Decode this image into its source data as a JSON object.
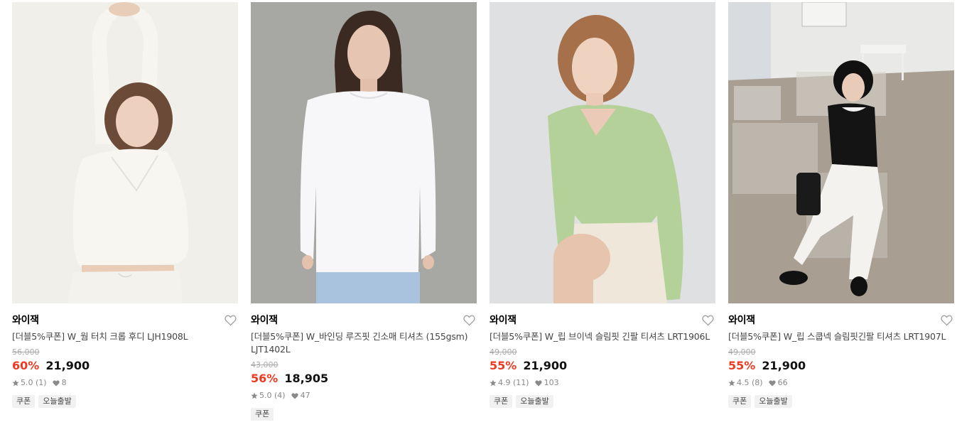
{
  "products": [
    {
      "brand": "와이잭",
      "title": "[더블5%쿠폰] W_웜 터치 크롭 후디 LJH1908L",
      "original_price": "56,000",
      "discount": "60%",
      "price": "21,900",
      "rating": "5.0 (1)",
      "likes": "8",
      "tags": [
        "쿠폰",
        "오늘출발"
      ],
      "image": "woman in cream cropped hoodie stretching arms overhead"
    },
    {
      "brand": "와이잭",
      "title": "[더블5%쿠폰] W_바인딩 루즈핏 긴소매 티셔츠 (155gsm) LJT1402L",
      "original_price": "43,000",
      "discount": "56%",
      "price": "18,905",
      "rating": "5.0 (4)",
      "likes": "47",
      "tags": [
        "쿠폰"
      ],
      "image": "woman in white loose long sleeve t-shirt on gray backdrop"
    },
    {
      "brand": "와이잭",
      "title": "[더블5%쿠폰] W_립 브이넥 슬림핏 긴팔 티셔츠 LRT1906L",
      "original_price": "49,000",
      "discount": "55%",
      "price": "21,900",
      "rating": "4.9 (11)",
      "likes": "103",
      "tags": [
        "쿠폰",
        "오늘출발"
      ],
      "image": "woman in mint green ribbed v-neck long sleeve seated"
    },
    {
      "brand": "와이잭",
      "title": "[더블5%쿠폰] W_립 스쿱넥 슬림핏긴팔 티셔츠 LRT1907L",
      "original_price": "49,000",
      "discount": "55%",
      "price": "21,900",
      "rating": "4.5 (8)",
      "likes": "66",
      "tags": [
        "쿠폰",
        "오늘출발"
      ],
      "image": "woman in black scoop neck top and white pants sitting on acrylic bench"
    }
  ],
  "icons": {
    "wishlist": "heart-outline-icon",
    "rating": "star-icon",
    "likes": "heart-filled-icon"
  },
  "colors": {
    "discount": "#ee3a23",
    "tag_bg": "#f1f1f1",
    "muted": "#888888"
  }
}
